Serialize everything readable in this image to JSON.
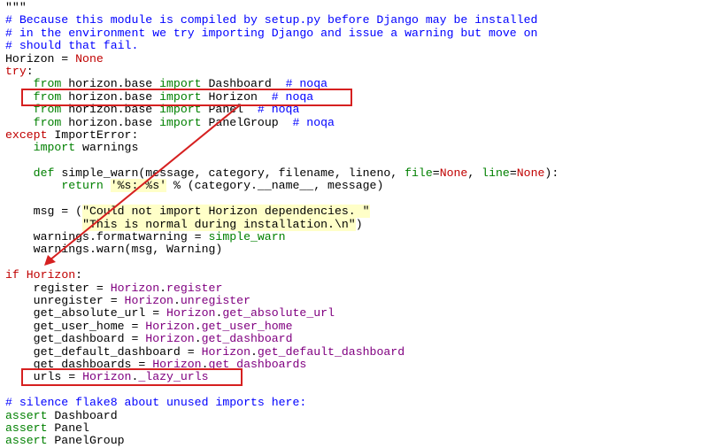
{
  "lines": [
    "\"\"\"",
    "# Because this module is compiled by setup.py before Django may be installed",
    "# in the environment we try importing Django and issue a warning but move on",
    "# should that fail.",
    "Horizon = None",
    "try:",
    "    from horizon.base import Dashboard  # noqa",
    "    from horizon.base import Horizon  # noqa",
    "    from horizon.base import Panel  # noqa",
    "    from horizon.base import PanelGroup  # noqa",
    "except ImportError:",
    "    import warnings",
    "",
    "    def simple_warn(message, category, filename, lineno, file=None, line=None):",
    "        return '%s: %s' % (category.__name__, message)",
    "",
    "    msg = (\"Could not import Horizon dependencies. \"",
    "           \"This is normal during installation.\\n\")",
    "    warnings.formatwarning = simple_warn",
    "    warnings.warn(msg, Warning)",
    "",
    "if Horizon:",
    "    register = Horizon.register",
    "    unregister = Horizon.unregister",
    "    get_absolute_url = Horizon.get_absolute_url",
    "    get_user_home = Horizon.get_user_home",
    "    get_dashboard = Horizon.get_dashboard",
    "    get_default_dashboard = Horizon.get_default_dashboard",
    "    get_dashboards = Horizon.get_dashboards",
    "    urls = Horizon._lazy_urls",
    "",
    "# silence flake8 about unused imports here:",
    "assert Dashboard",
    "assert Panel",
    "assert PanelGroup"
  ],
  "annotations": {
    "box_color": "#d62020",
    "highlighted_import": "from horizon.base import Horizon  # noqa",
    "highlighted_usage": "urls = Horizon._lazy_urls",
    "arrow": "from import Horizon to if Horizon"
  }
}
